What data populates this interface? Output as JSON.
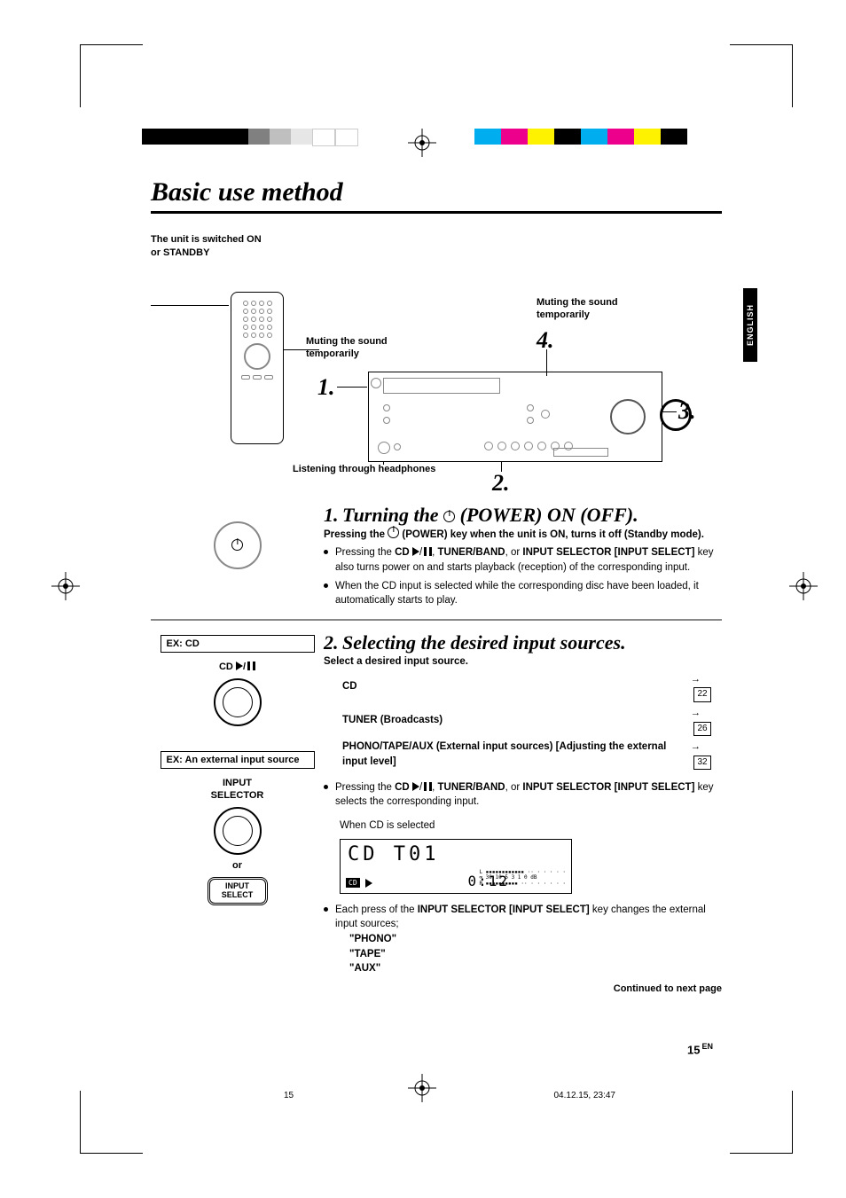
{
  "section_title": "Basic use method",
  "language_tab": "ENGLISH",
  "top": {
    "switch_label": "The unit is switched ON or STANDBY",
    "mute_label": "Muting the sound temporarily",
    "mute_label2": "Muting the sound temporarily",
    "headphones_label": "Listening through headphones",
    "nums": {
      "n1": "1.",
      "n2": "2.",
      "n3": "3.",
      "n4": "4."
    }
  },
  "step1": {
    "num": "1.",
    "title_a": "Turning the ",
    "title_b": " (POWER) ON (OFF).",
    "line1_a": "Pressing the ",
    "line1_b": " (POWER) key when the unit is ON, turns it off (Standby mode).",
    "b1_a": "Pressing the ",
    "b1_cd": "CD ",
    "b1_b": ", ",
    "b1_tb": "TUNER/BAND",
    "b1_c": ", or ",
    "b1_is": "INPUT SELECTOR [INPUT SELECT]",
    "b1_d": " key also turns power on and starts playback (reception) of the corresponding input.",
    "b2": "When the CD input is selected while the corresponding disc have been loaded, it automatically starts to play."
  },
  "step2": {
    "num": "2.",
    "title": "Selecting the desired input sources.",
    "select_hdr": "Select a desired input source.",
    "rows": [
      {
        "label": "CD",
        "page": "22"
      },
      {
        "label": "TUNER (Broadcasts)",
        "page": "26"
      },
      {
        "label": "PHONO/TAPE/AUX (External input sources) [Adjusting the external input level]",
        "page": "32"
      }
    ],
    "b1_a": "Pressing the ",
    "b1_cd": "CD ",
    "b1_b": ", ",
    "b1_tb": "TUNER/BAND",
    "b1_c": ", or ",
    "b1_is": "INPUT SELECTOR [INPUT SELECT]",
    "b1_d": " key selects the corresponding input.",
    "when_cd": "When CD is selected",
    "lcd": {
      "main": "CD   T01",
      "badge": "CD",
      "time": "0:12",
      "meter_top": "L ▪▪▪▪▪▪▪▪▪▪▪▪ ·· · · · · ·",
      "meter_scale": "∞ 30 10 5 3 1 0 dB",
      "meter_bot": "R ▪▪▪▪▪▪▪▪▪▪ ·· · · · · · ·"
    },
    "b2_a": "Each press of the ",
    "b2_is": "INPUT SELECTOR [INPUT SELECT]",
    "b2_b": " key changes the external input sources;",
    "ext": [
      "\"PHONO\"",
      "\"TAPE\"",
      "\"AUX\""
    ]
  },
  "left": {
    "ex_cd": "EX: CD",
    "cd_label": "CD",
    "ex_ext": "EX: An external input source",
    "input_sel": "INPUT\nSELECTOR",
    "or": "or",
    "btn": "INPUT\nSELECT"
  },
  "footer": {
    "continued": "Continued to next page",
    "page": "15",
    "en": "EN",
    "print_page": "15",
    "print_date": "04.12.15, 23:47"
  },
  "colorbars": {
    "left": [
      "#000",
      "#000",
      "#000",
      "#000",
      "#000",
      "#808080",
      "#bfbfbf",
      "#e6e6e6",
      "#fff",
      "#fff"
    ],
    "right": [
      "#00aeef",
      "#ec008c",
      "#fff200",
      "#000",
      "#00aeef",
      "#ec008c",
      "#fff200",
      "#000"
    ]
  }
}
